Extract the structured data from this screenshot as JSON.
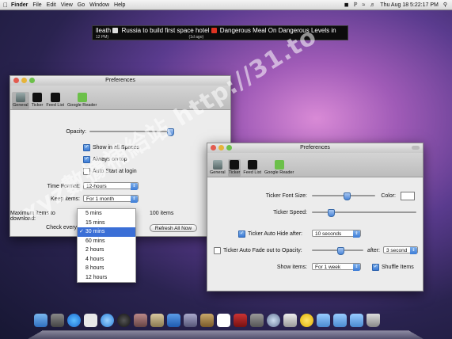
{
  "menubar": {
    "app_name": "Finder",
    "menus": [
      "File",
      "Edit",
      "View",
      "Go",
      "Window",
      "Help"
    ],
    "clock": "Thu Aug 18  5:22:17 PM",
    "spotlight_icon": "search-icon"
  },
  "ticker": {
    "item1": "Russia to build first space hotel",
    "item2": "Dangerous Meal On Dangerous Levels in",
    "left_fragment": "lleath",
    "left_time": "12 PM)",
    "item1_time": "(1d ago)"
  },
  "prefs_left": {
    "title": "Preferences",
    "tabs": [
      "General",
      "Ticker",
      "Feed List",
      "Google Reader"
    ],
    "opacity_label": "Opacity:",
    "opacity_value": 0.88,
    "show_all_spaces": "Show in all Spaces",
    "always_on_top": "Always on top",
    "auto_start": "Auto Start at login",
    "time_format_label": "Time Format:",
    "time_format_value": "12-hours",
    "keep_items_label": "Keep items:",
    "keep_items_value": "For 1 month",
    "max_items_label": "Maximum items to download:",
    "max_items_value": "100 items",
    "check_every_label": "Check every:",
    "refresh_button": "Refresh All Now",
    "check_options": [
      "5 mins",
      "15 mins",
      "30 mins",
      "60 mins",
      "2 hours",
      "4 hours",
      "8 hours",
      "12 hours"
    ],
    "check_selected": "30 mins"
  },
  "prefs_right": {
    "title": "Preferences",
    "tabs": [
      "General",
      "Ticker",
      "Feed List",
      "Google Reader"
    ],
    "font_size_label": "Ticker Font Size:",
    "color_label": "Color:",
    "speed_label": "Ticker Speed:",
    "auto_hide_label": "Ticker Auto Hide after:",
    "auto_hide_value": "10 seconds",
    "fade_label": "Ticker Auto Fade out to Opacity:",
    "after_label": "after:",
    "after_value": "3 second",
    "show_items_label": "Show items:",
    "show_items_value": "For 1 week",
    "shuffle_label": "Shuffle Items",
    "font_size_value": 0.33,
    "speed_value": 0.18,
    "fade_opacity_value": 0.28
  },
  "watermark": "xyz數據補給站 http://31.to",
  "colors": {
    "accent": "#3b6fd6",
    "green": "#6cc04a"
  }
}
